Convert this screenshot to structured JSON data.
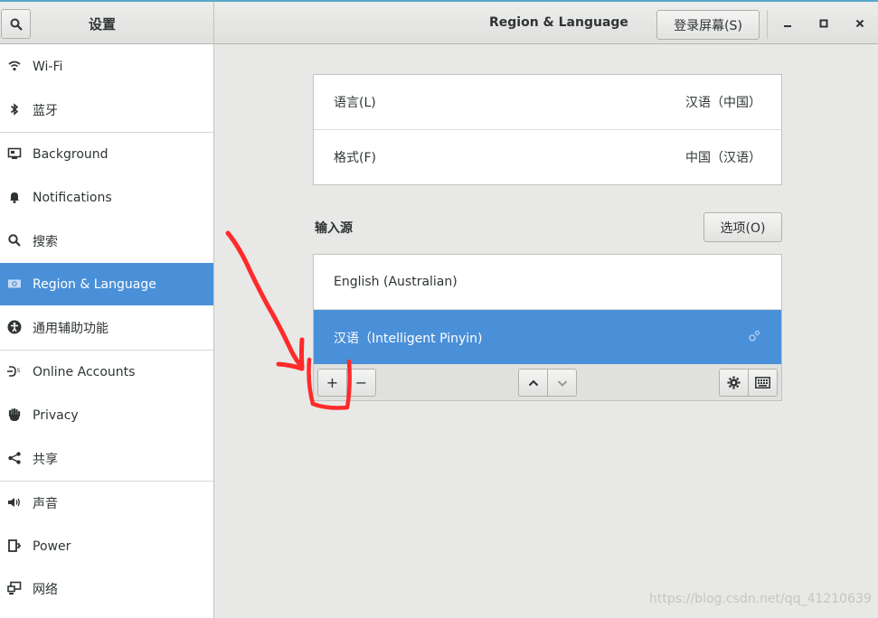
{
  "header": {
    "app_title": "设置",
    "page_title": "Region & Language",
    "login_screen_label": "登录屏幕(S)"
  },
  "sidebar": {
    "items": [
      {
        "label": "Wi-Fi",
        "icon": "wifi-icon"
      },
      {
        "label": "蓝牙",
        "icon": "bluetooth-icon"
      },
      {
        "label": "Background",
        "icon": "background-icon"
      },
      {
        "label": "Notifications",
        "icon": "bell-icon"
      },
      {
        "label": "搜索",
        "icon": "search-icon"
      },
      {
        "label": "Region & Language",
        "icon": "region-flag-icon",
        "active": true
      },
      {
        "label": "通用辅助功能",
        "icon": "accessibility-icon"
      },
      {
        "label": "Online Accounts",
        "icon": "online-accounts-icon"
      },
      {
        "label": "Privacy",
        "icon": "hand-icon"
      },
      {
        "label": "共享",
        "icon": "share-icon"
      },
      {
        "label": "声音",
        "icon": "speaker-icon"
      },
      {
        "label": "Power",
        "icon": "power-icon"
      },
      {
        "label": "网络",
        "icon": "network-icon"
      }
    ]
  },
  "language_panel": {
    "language_label": "语言(L)",
    "language_value": "汉语（中国）",
    "format_label": "格式(F)",
    "format_value": "中国（汉语）"
  },
  "input_sources": {
    "title": "输入源",
    "options_label": "选项(O)",
    "sources": [
      {
        "label": "English (Australian)",
        "selected": false
      },
      {
        "label": "汉语（Intelligent Pinyin)",
        "selected": true
      }
    ],
    "add_label": "+",
    "remove_label": "−"
  },
  "watermark": "https://blog.csdn.net/qq_41210639",
  "colors": {
    "accent": "#4a90d9",
    "annotation": "#ff2a2a"
  }
}
